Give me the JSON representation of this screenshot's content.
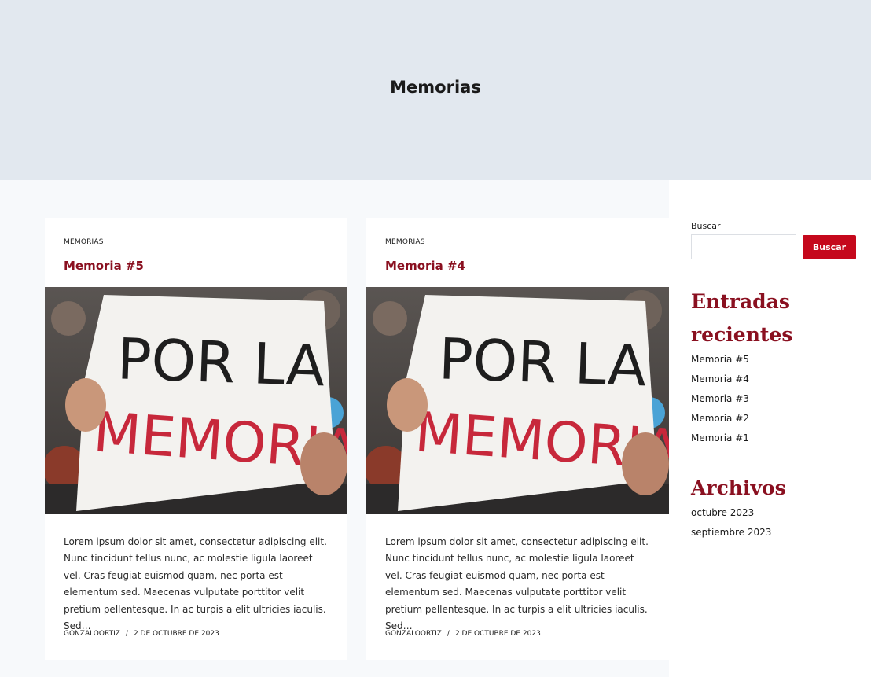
{
  "hero": {
    "title": "Memorias"
  },
  "posts": [
    {
      "category": "MEMORIAS",
      "title": "Memoria #5",
      "image": {
        "sign_line1": "POR LA",
        "sign_line2": "MEMORIA"
      },
      "excerpt": "Lorem ipsum dolor sit amet, consectetur adipiscing elit. Nunc tincidunt tellus nunc, ac molestie ligula laoreet vel. Cras feugiat euismod quam, nec porta est elementum sed. Maecenas vulputate porttitor velit pretium pellentesque. In ac turpis a elit ultricies iaculis. Sed…",
      "author": "GONZALOORTIZ",
      "separator": "/",
      "date": "2 DE OCTUBRE DE 2023"
    },
    {
      "category": "MEMORIAS",
      "title": "Memoria #4",
      "image": {
        "sign_line1": "POR LA",
        "sign_line2": "MEMORIA"
      },
      "excerpt": "Lorem ipsum dolor sit amet, consectetur adipiscing elit. Nunc tincidunt tellus nunc, ac molestie ligula laoreet vel. Cras feugiat euismod quam, nec porta est elementum sed. Maecenas vulputate porttitor velit pretium pellentesque. In ac turpis a elit ultricies iaculis. Sed…",
      "author": "GONZALOORTIZ",
      "separator": "/",
      "date": "2 DE OCTUBRE DE 2023"
    }
  ],
  "sidebar": {
    "search": {
      "label": "Buscar",
      "value": "",
      "button": "Buscar"
    },
    "recent": {
      "title": "Entradas recientes",
      "items": [
        "Memoria #5",
        "Memoria #4",
        "Memoria #3",
        "Memoria #2",
        "Memoria #1"
      ]
    },
    "archive": {
      "title": "Archivos",
      "items": [
        "octubre 2023",
        "septiembre 2023"
      ]
    }
  },
  "colors": {
    "accent": "#8a1020",
    "button": "#c5081c",
    "hero_bg": "#e2e8ef",
    "page_bg": "#f7f9fb"
  }
}
